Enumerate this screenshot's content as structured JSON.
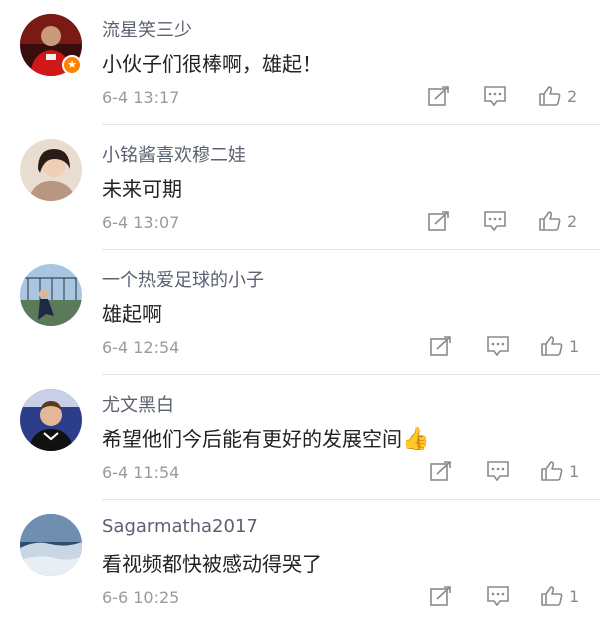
{
  "comments": [
    {
      "user": "流星笑三少",
      "text": "小伙子们很棒啊，雄起！",
      "time": "6-4 13:17",
      "likes": "2",
      "verified": true
    },
    {
      "user": "小铭酱喜欢穆二娃",
      "text": "未来可期",
      "time": "6-4 13:07",
      "likes": "2"
    },
    {
      "user": "一个热爱足球的小子",
      "text": "雄起啊",
      "time": "6-4 12:54",
      "likes": "1"
    },
    {
      "user": "尤文黑白",
      "text": "希望他们今后能有更好的发展空间",
      "emoji": "👍",
      "time": "6-4 11:54",
      "likes": "1"
    },
    {
      "user": "Sagarmatha2017",
      "text": "看视频都快被感动得哭了",
      "time": "6-6 10:25",
      "likes": "1"
    }
  ],
  "icons": {
    "share": "share-icon",
    "reply": "comment-icon",
    "like": "thumbs-up-icon",
    "verified": "verified-badge-icon"
  },
  "colors": {
    "name": "#5b6170",
    "text": "#222222",
    "meta": "#9a9a9a",
    "badge": "#ff8200"
  }
}
